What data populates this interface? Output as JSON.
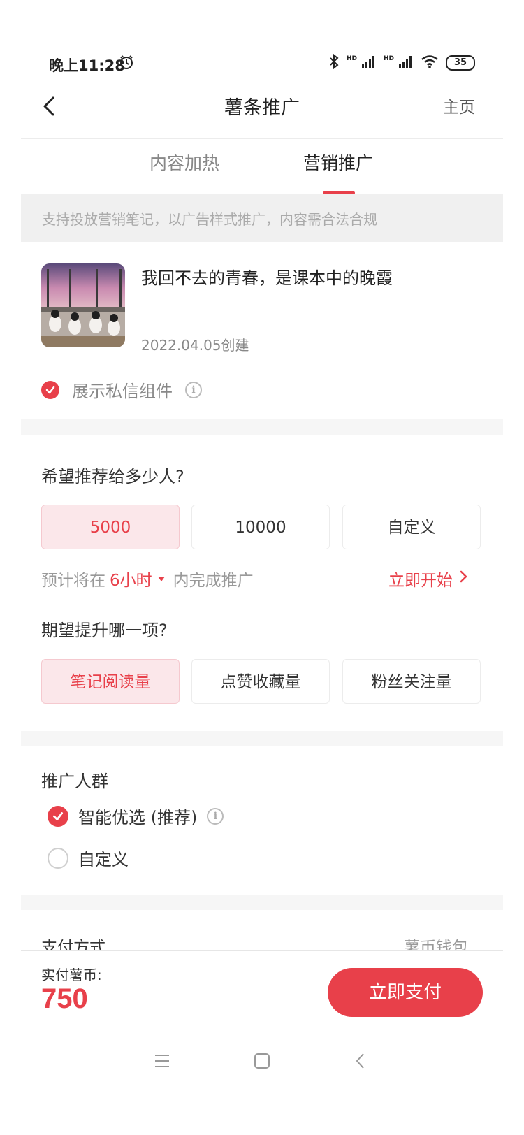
{
  "status_bar": {
    "time": "晚上11:28",
    "battery": "35",
    "signal_label": "HD"
  },
  "nav": {
    "title": "薯条推广",
    "home_label": "主页"
  },
  "tabs": [
    {
      "label": "内容加热"
    },
    {
      "label": "营销推广"
    }
  ],
  "notice": "支持投放营销笔记，以广告样式推广，内容需合法合规",
  "note": {
    "title": "我回不去的青春，是课本中的晚霞",
    "date": "2022.04.05创建"
  },
  "dm_widget": {
    "label": "展示私信组件",
    "checked": true
  },
  "reach": {
    "question": "希望推荐给多少人?",
    "options": [
      "5000",
      "10000",
      "自定义"
    ],
    "selected": "5000",
    "estimate_prefix": "预计将在",
    "estimate_time": "6小时",
    "estimate_suffix": "内完成推广",
    "start_label": "立即开始"
  },
  "goal": {
    "question": "期望提升哪一项?",
    "options": [
      "笔记阅读量",
      "点赞收藏量",
      "粉丝关注量"
    ],
    "selected": "笔记阅读量"
  },
  "audience": {
    "title": "推广人群",
    "options": [
      {
        "label": "智能优选 (推荐)",
        "checked": true
      },
      {
        "label": "自定义",
        "checked": false
      }
    ]
  },
  "payment": {
    "label": "支付方式",
    "value": "薯币钱包"
  },
  "bottom": {
    "amount_label": "实付薯币:",
    "amount": "750",
    "pay_button": "立即支付"
  },
  "colors": {
    "accent": "#e8404a",
    "accent_light": "#fbe7ea"
  }
}
